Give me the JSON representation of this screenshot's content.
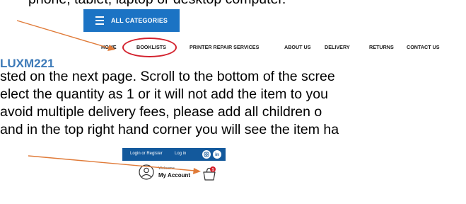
{
  "document": {
    "line_top": "phone, tablet, laptop or desktop computer.",
    "store_code": "LUXM221",
    "line_1": "sted on the next page. Scroll to the bottom of the scree",
    "line_2": "elect the quantity as 1 or it will not add the item to you",
    "line_3": " avoid multiple delivery fees, please add all children o",
    "line_4": "and in the top right hand corner you will see the item ha"
  },
  "categories_button": {
    "label": "ALL CATEGORIES",
    "icon": "hamburger-menu-icon",
    "color": "#1b73c4"
  },
  "nav": {
    "items": [
      {
        "label": "HOME"
      },
      {
        "label": "BOOKLISTS",
        "highlighted": true
      },
      {
        "label": "PRINTER REPAIR SERVICES"
      },
      {
        "label": "ABOUT US"
      },
      {
        "label": "DELIVERY"
      },
      {
        "label": "RETURNS"
      },
      {
        "label": "CONTACT US"
      }
    ]
  },
  "account_bar": {
    "login_register": "Login or Register",
    "login": "Log in",
    "instagram_icon": "instagram-icon",
    "linkedin_label": "in",
    "color": "#13599c"
  },
  "account": {
    "welcome": "Welcome",
    "my_account": "My Account",
    "cart_badge": "1",
    "user_icon": "user-icon",
    "cart_icon": "shopping-bag-icon"
  },
  "annotations": {
    "arrow_color": "#e07b39",
    "circle_color": "#d3202c"
  }
}
